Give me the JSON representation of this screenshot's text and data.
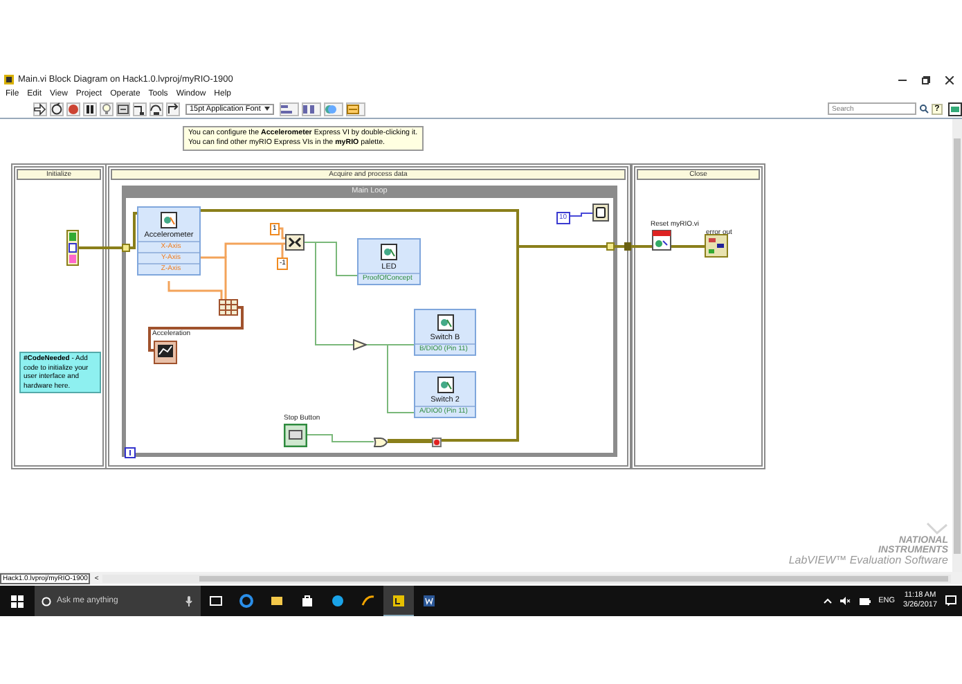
{
  "window": {
    "title": "Main.vi Block Diagram on Hack1.0.lvproj/myRIO-1900"
  },
  "menu": [
    "File",
    "Edit",
    "View",
    "Project",
    "Operate",
    "Tools",
    "Window",
    "Help"
  ],
  "toolbar": {
    "font": "15pt Application Font",
    "search": {
      "placeholder": "Search"
    },
    "help": "?"
  },
  "tooltip": {
    "lines": [
      "You can configure the **Accelerometer** Express VI by double-clicking it.",
      "You can find other myRIO Express VIs in the **myRIO** palette."
    ]
  },
  "diagram": {
    "frames": [
      {
        "label": "Initialize"
      },
      {
        "label": "Acquire and process data"
      },
      {
        "label": "Close"
      }
    ],
    "loop": {
      "label": "Main Loop"
    },
    "express_vis": [
      {
        "title": "Accelerometer",
        "terminals": [
          {
            "label": "X-Axis",
            "kind": "numeric"
          },
          {
            "label": "Y-Axis",
            "kind": "numeric"
          },
          {
            "label": "Z-Axis",
            "kind": "numeric"
          }
        ]
      },
      {
        "title": "LED",
        "terminals": [
          {
            "label": "ProofOfConcept",
            "kind": "boolean"
          }
        ]
      },
      {
        "title": "Switch B",
        "terminals": [
          {
            "label": "B/DIO0 (Pin 11)",
            "kind": "boolean"
          }
        ]
      },
      {
        "title": "Switch 2",
        "terminals": [
          {
            "label": "A/DIO0 (Pin 11)",
            "kind": "boolean"
          }
        ]
      }
    ],
    "constants": [
      {
        "value": "1",
        "kind": "numeric"
      },
      {
        "value": "-1",
        "kind": "numeric"
      },
      {
        "value": "10",
        "kind": "integer"
      }
    ],
    "labels": [
      "Acceleration",
      "Stop Button",
      "Reset myRIO.vi",
      "error out"
    ],
    "comment": "**#CodeNeeded** - Add code to initialize your user interface and hardware here."
  },
  "status_bar": {
    "path": "Hack1.0.lvproj/myRIO-1900",
    "scroll": "<"
  },
  "evaluation_notice": [
    "NATIONAL",
    "INSTRUMENTS",
    "LabVIEW™ Evaluation Software"
  ],
  "taskbar": {
    "search": {
      "placeholder": "Ask me anything"
    },
    "apps": [
      {
        "selected": false
      },
      {
        "selected": false
      },
      {
        "selected": false
      },
      {
        "selected": false
      },
      {
        "selected": false
      },
      {
        "selected": false
      },
      {
        "selected": true
      },
      {
        "selected": false
      }
    ],
    "language": "ENG",
    "time": "11:18 AM",
    "date": "3/26/2017"
  }
}
